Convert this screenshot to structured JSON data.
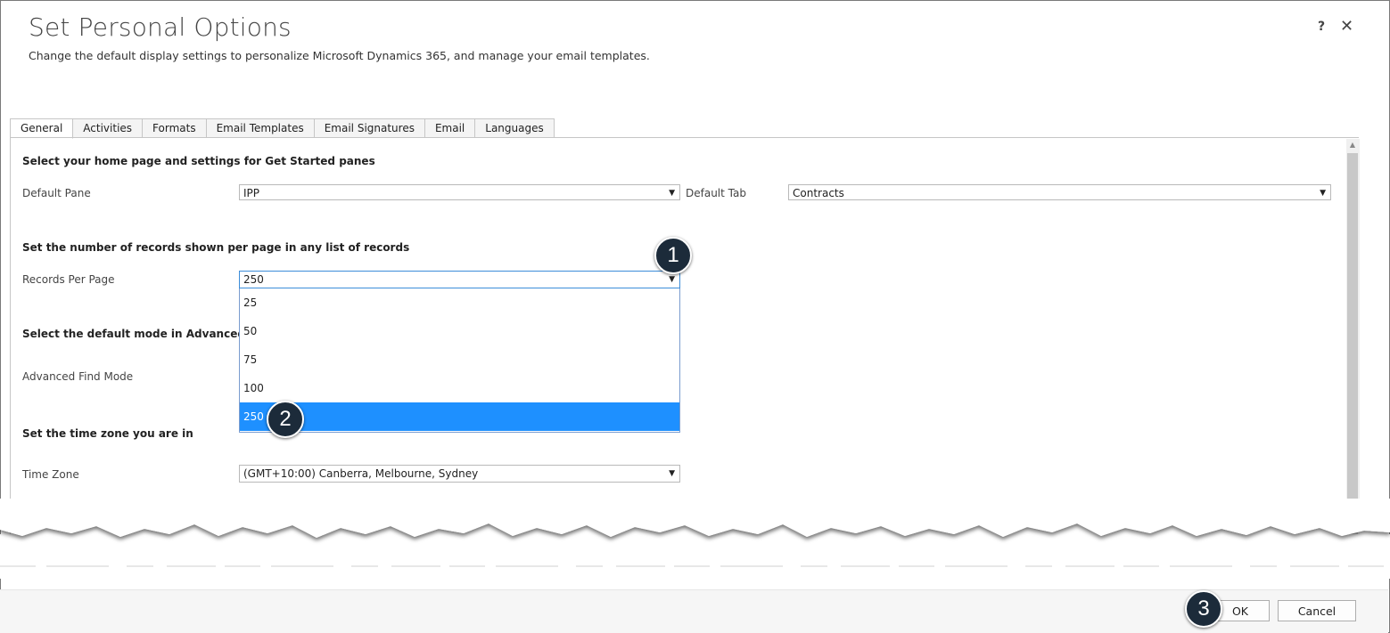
{
  "dialog": {
    "title": "Set Personal Options",
    "subtitle": "Change the default display settings to personalize Microsoft Dynamics 365, and manage your email templates.",
    "help_label": "?",
    "close_label": "✕"
  },
  "tabs": [
    {
      "label": "General"
    },
    {
      "label": "Activities"
    },
    {
      "label": "Formats"
    },
    {
      "label": "Email Templates"
    },
    {
      "label": "Email Signatures"
    },
    {
      "label": "Email"
    },
    {
      "label": "Languages"
    }
  ],
  "active_tab": "General",
  "general": {
    "home_section": "Select your home page and settings for Get Started panes",
    "default_pane_label": "Default Pane",
    "default_pane_value": "IPP",
    "default_tab_label": "Default Tab",
    "default_tab_value": "Contracts",
    "records_section": "Set the number of records shown per page in any list of records",
    "records_label": "Records Per Page",
    "records_value": "250",
    "records_options": [
      "25",
      "50",
      "75",
      "100",
      "250"
    ],
    "advanced_section": "Select the default mode in Advanced Find",
    "advanced_label": "Advanced Find Mode",
    "timezone_section": "Set the time zone you are in",
    "timezone_label": "Time Zone",
    "timezone_value": "(GMT+10:00) Canberra, Melbourne, Sydney"
  },
  "callouts": [
    "1",
    "2",
    "3"
  ],
  "footer": {
    "ok_label": "OK",
    "cancel_label": "Cancel"
  },
  "colors": {
    "selection": "#1e90ff",
    "badge": "#1c2b3a"
  }
}
